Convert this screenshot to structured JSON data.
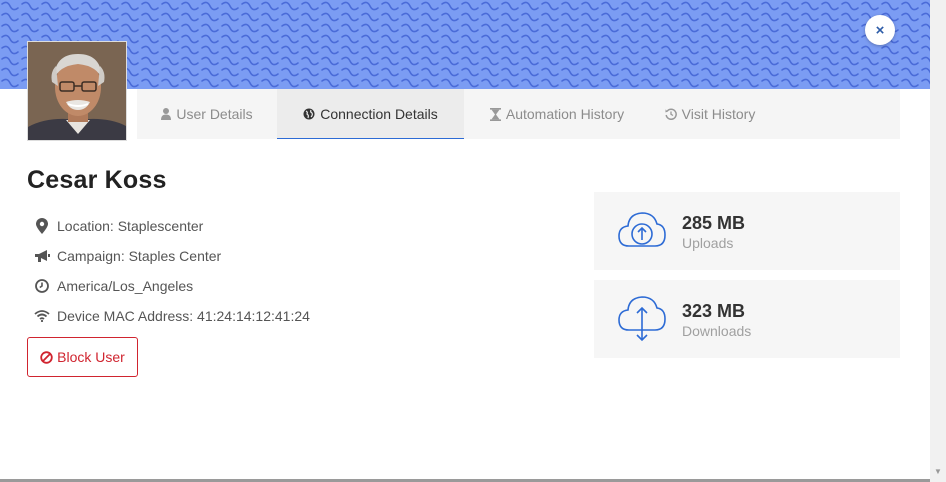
{
  "banner": {
    "color": "#7b9cf3",
    "wave_color": "#4a6bd8"
  },
  "close": {
    "label": "×",
    "icon": "close-icon"
  },
  "avatar": {
    "description_icon": "user-photo"
  },
  "tabs": [
    {
      "label": "User Details",
      "icon": "user-icon",
      "active": false
    },
    {
      "label": "Connection Details",
      "icon": "globe-icon",
      "active": true
    },
    {
      "label": "Automation History",
      "icon": "hourglass-icon",
      "active": false
    },
    {
      "label": "Visit History",
      "icon": "history-icon",
      "active": false
    }
  ],
  "user": {
    "name": "Cesar Koss",
    "location": "Location: Staplescenter",
    "campaign": "Campaign: Staples Center",
    "timezone": "America/Los_Angeles",
    "mac": "Device MAC Address: 41:24:14:12:41:24"
  },
  "actions": {
    "block_label": "Block User"
  },
  "stats": {
    "uploads": {
      "value": "285 MB",
      "label": "Uploads",
      "icon": "cloud-upload-icon"
    },
    "downloads": {
      "value": "323 MB",
      "label": "Downloads",
      "icon": "cloud-updown-icon"
    }
  },
  "colors": {
    "accent": "#2d6bd5",
    "danger": "#d0242f",
    "cloud_icon": "#2d6bd5"
  }
}
